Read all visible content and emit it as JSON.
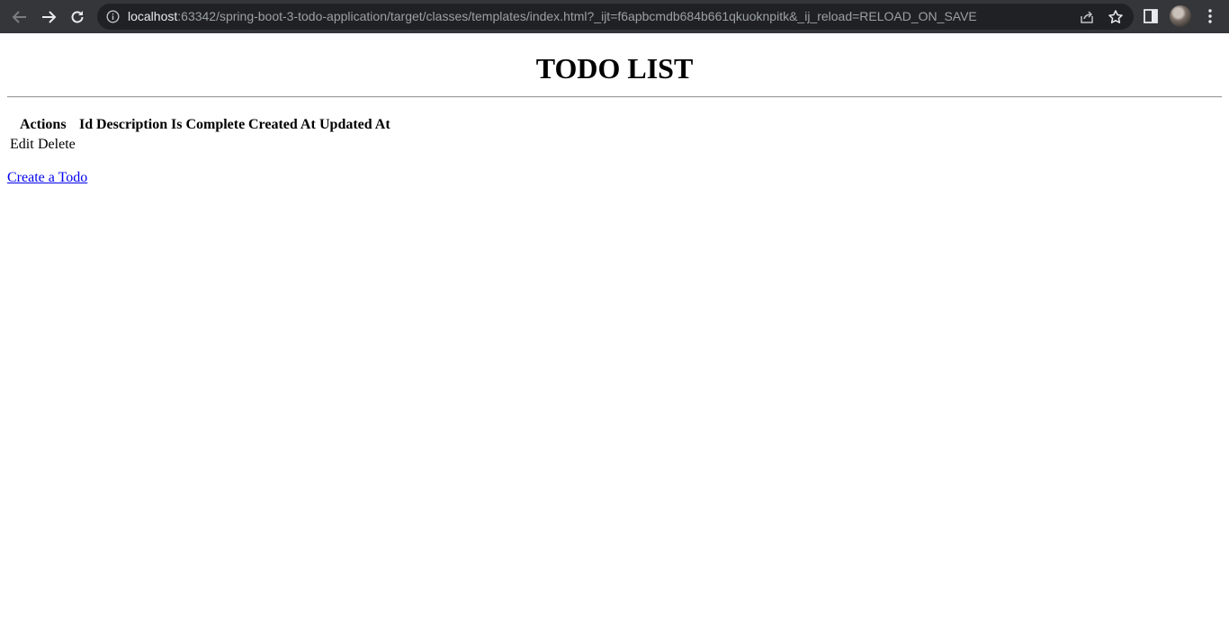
{
  "browser": {
    "url_host": "localhost",
    "url_rest": ":63342/spring-boot-3-todo-application/target/classes/templates/index.html?_ijt=f6apbcmdb684b661qkuoknpitk&_ij_reload=RELOAD_ON_SAVE"
  },
  "page": {
    "title": "TODO LIST",
    "table": {
      "headers": [
        "Actions",
        "Id",
        "Description",
        "Is Complete",
        "Created At",
        "Updated At"
      ],
      "row": {
        "edit_label": "Edit",
        "delete_label": "Delete"
      }
    },
    "create_link": "Create a Todo"
  }
}
